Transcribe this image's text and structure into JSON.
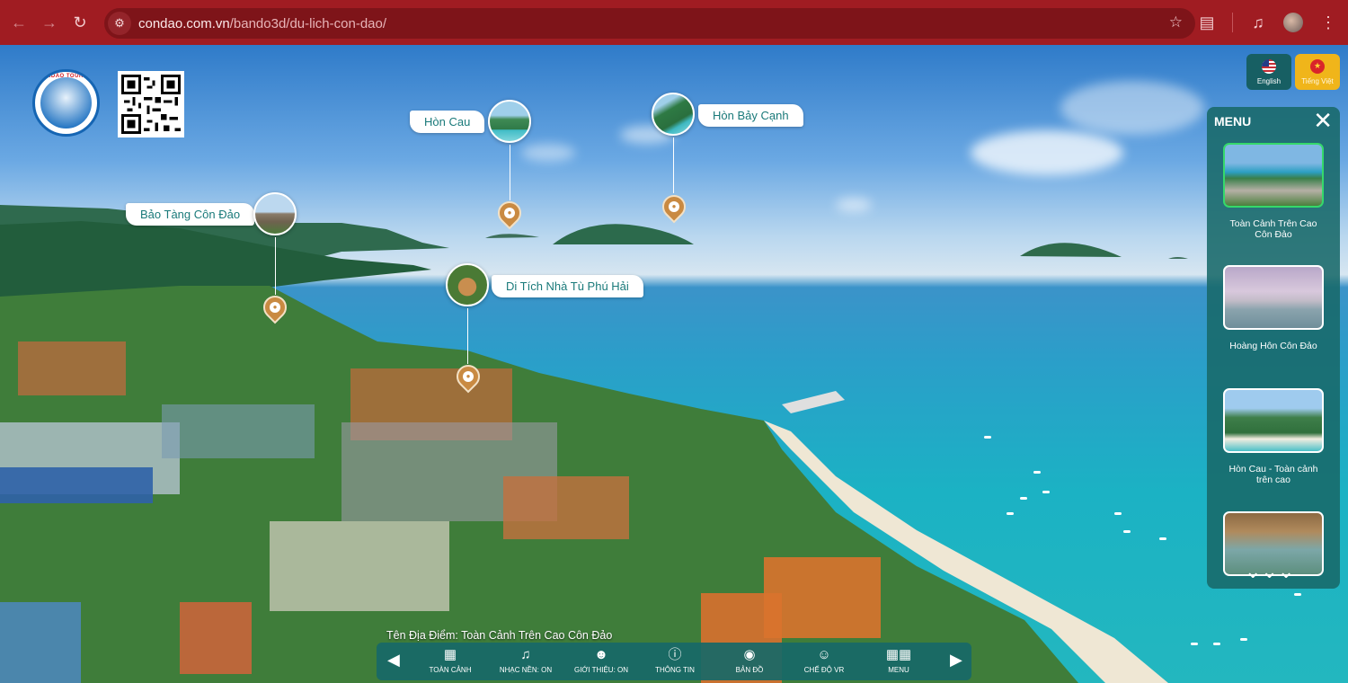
{
  "browser": {
    "url_host": "condao.com.vn",
    "url_path": "/bando3d/du-lich-con-dao/",
    "icons": [
      "back-icon",
      "forward-icon",
      "reload-icon",
      "site-settings-icon",
      "star-icon",
      "extensions-icon",
      "media-icon",
      "profile-avatar",
      "more-icon"
    ]
  },
  "logo": {
    "text": "CONDAO TOURISM"
  },
  "language": {
    "english": "English",
    "vietnamese": "Tiếng Việt"
  },
  "hotspots": [
    {
      "label": "Hòn Cau"
    },
    {
      "label": "Hòn Bảy Cạnh"
    },
    {
      "label": "Bảo Tàng Côn Đảo"
    },
    {
      "label": "Di Tích Nhà Tù Phú Hải"
    }
  ],
  "menu": {
    "title": "MENU",
    "items": [
      {
        "caption": "Toàn Cảnh Trên Cao Côn Đảo",
        "active": true
      },
      {
        "caption": "Hoàng Hôn Côn Đảo",
        "active": false
      },
      {
        "caption": "Hòn Cau - Toàn cảnh trên cao",
        "active": false
      },
      {
        "caption": "",
        "active": false
      }
    ]
  },
  "place_name": "Tên Địa Điểm: Toàn Cảnh Trên Cao Côn Đảo",
  "toolbar": {
    "items": [
      {
        "label": "TOÀN CẢNH",
        "icon": "building-icon"
      },
      {
        "label": "NHẠC NỀN: ON",
        "icon": "music-icon"
      },
      {
        "label": "GIỚI THIỆU: ON",
        "icon": "people-icon"
      },
      {
        "label": "THÔNG TIN",
        "icon": "info-icon"
      },
      {
        "label": "BẢN ĐỒ",
        "icon": "map-icon"
      },
      {
        "label": "CHẾ ĐỘ VR",
        "icon": "vr-icon"
      },
      {
        "label": "MENU",
        "icon": "grid-icon"
      }
    ]
  }
}
